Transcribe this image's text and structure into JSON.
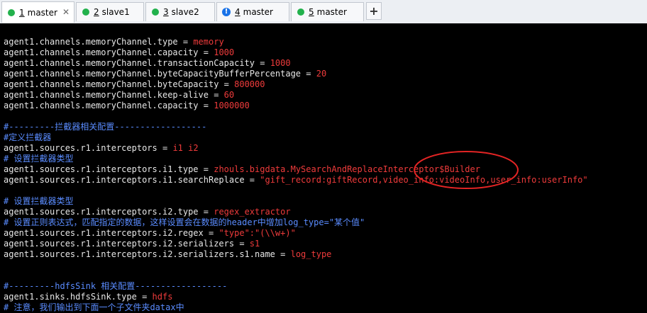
{
  "tabs": [
    {
      "num": "1",
      "label": "master",
      "status": "green",
      "active": true
    },
    {
      "num": "2",
      "label": "slave1",
      "status": "green",
      "active": false
    },
    {
      "num": "3",
      "label": "slave2",
      "status": "green",
      "active": false
    },
    {
      "num": "4",
      "label": "master",
      "status": "info",
      "active": false
    },
    {
      "num": "5",
      "label": "master",
      "status": "green",
      "active": false
    }
  ],
  "new_tab_label": "+",
  "close_glyph": "✕",
  "lines": [
    {
      "k": "agent1.channels.memoryChannel.type",
      "v": "memory"
    },
    {
      "k": "agent1.channels.memoryChannel.capacity",
      "v": "1000"
    },
    {
      "k": "agent1.channels.memoryChannel.transactionCapacity",
      "v": "1000"
    },
    {
      "k": "agent1.channels.memoryChannel.byteCapacityBufferPercentage",
      "v": "20"
    },
    {
      "k": "agent1.channels.memoryChannel.byteCapacity",
      "v": "800000"
    },
    {
      "k": "agent1.channels.memoryChannel.keep-alive",
      "v": "60"
    },
    {
      "k": "agent1.channels.memoryChannel.capacity",
      "v": "1000000"
    },
    {
      "c": "#---------拦截器相关配置------------------"
    },
    {
      "c": "#定义拦截器"
    },
    {
      "k": "agent1.sources.r1.interceptors",
      "v": "i1 i2"
    },
    {
      "c": "# 设置拦截器类型"
    },
    {
      "k": "agent1.sources.r1.interceptors.i1.type",
      "v": "zhouls.bigdata.MySearchAndReplaceInterceptor$Builder"
    },
    {
      "k": "agent1.sources.r1.interceptors.i1.searchReplace",
      "v": "\"gift_record:giftRecord,video_info:videoInfo,user_info:userInfo\""
    },
    {
      "c": "# 设置拦截器类型"
    },
    {
      "k": "agent1.sources.r1.interceptors.i2.type",
      "v": "regex_extractor"
    },
    {
      "c": "# 设置正则表达式，匹配指定的数据，这样设置会在数据的header中增加log_type=\"某个值\""
    },
    {
      "k": "agent1.sources.r1.interceptors.i2.regex",
      "v": "\"type\":\"(\\\\w+)\""
    },
    {
      "k": "agent1.sources.r1.interceptors.i2.serializers",
      "v": "s1"
    },
    {
      "k": "agent1.sources.r1.interceptors.i2.serializers.s1.name",
      "v": "log_type"
    },
    {
      "c": "#---------hdfsSink 相关配置------------------"
    },
    {
      "k": "agent1.sinks.hdfsSink.type",
      "v": "hdfs"
    },
    {
      "c": "# 注意，我们输出到下面一个子文件夹datax中"
    }
  ],
  "colors": {
    "key": "#e7e7e7",
    "value": "#ef3b3b",
    "comment": "#5a8cff",
    "annotation": "#e32424"
  }
}
